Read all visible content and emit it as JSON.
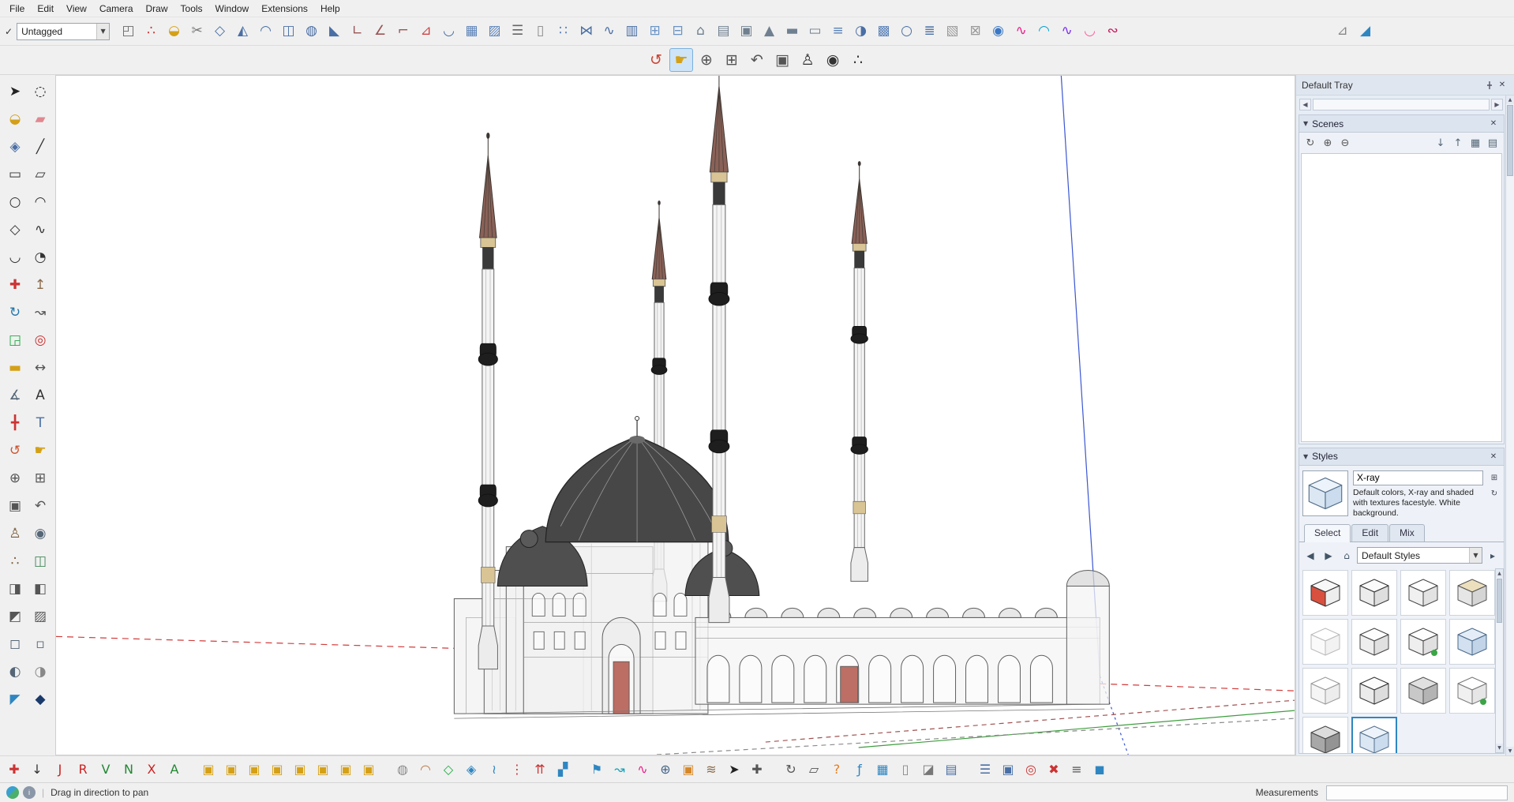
{
  "menu": {
    "items": [
      {
        "name": "menu-file",
        "label": "File"
      },
      {
        "name": "menu-edit",
        "label": "Edit"
      },
      {
        "name": "menu-view",
        "label": "View"
      },
      {
        "name": "menu-camera",
        "label": "Camera"
      },
      {
        "name": "menu-draw",
        "label": "Draw"
      },
      {
        "name": "menu-tools",
        "label": "Tools"
      },
      {
        "name": "menu-window",
        "label": "Window"
      },
      {
        "name": "menu-extensions",
        "label": "Extensions"
      },
      {
        "name": "menu-help",
        "label": "Help"
      }
    ]
  },
  "top_toolbar": {
    "tag_filter": {
      "value": "Untagged"
    },
    "icons": [
      {
        "name": "corner-tool-icon",
        "g": "◰",
        "c": "#6a6a6a"
      },
      {
        "name": "points-tool-icon",
        "g": "∴",
        "c": "#cc3333"
      },
      {
        "name": "drape-tool-icon",
        "g": "◒",
        "c": "#d4a017"
      },
      {
        "name": "cut-tool-icon",
        "g": "✂",
        "c": "#777777"
      },
      {
        "name": "polygon-tool-icon",
        "g": "◇",
        "c": "#4a6fa5"
      },
      {
        "name": "outline-tool-icon",
        "g": "◭",
        "c": "#4a6fa5"
      },
      {
        "name": "sweep-tool-icon",
        "g": "◠",
        "c": "#4a6fa5"
      },
      {
        "name": "extrude-tool-icon",
        "g": "◫",
        "c": "#4a6fa5"
      },
      {
        "name": "sphere-tool-icon",
        "g": "◍",
        "c": "#4a6fa5"
      },
      {
        "name": "taper-tool-icon",
        "g": "◣",
        "c": "#4a6fa5"
      },
      {
        "name": "angle-corner-tool-icon",
        "g": "∟",
        "c": "#995555"
      },
      {
        "name": "angle-tool-icon",
        "g": "∠",
        "c": "#995555"
      },
      {
        "name": "guide-tool-icon",
        "g": "⌐",
        "c": "#995555"
      },
      {
        "name": "slope-tool-icon",
        "g": "⊿",
        "c": "#cc4444"
      },
      {
        "name": "arc-tool-icon",
        "g": "◡",
        "c": "#4a6fa5"
      },
      {
        "name": "grid-tool-icon",
        "g": "▦",
        "c": "#5b82b8"
      },
      {
        "name": "hatch-tool-icon",
        "g": "▨",
        "c": "#5b82b8"
      },
      {
        "name": "stairs-tool-icon",
        "g": "☰",
        "c": "#666666"
      },
      {
        "name": "column-tool-icon",
        "g": "▯",
        "c": "#888888"
      },
      {
        "name": "array-tool-icon",
        "g": "∷",
        "c": "#5b82b8"
      },
      {
        "name": "mirror-tool-icon",
        "g": "⋈",
        "c": "#4a6fa5"
      },
      {
        "name": "path-array-tool-icon",
        "g": "∿",
        "c": "#4a6fa5"
      },
      {
        "name": "fence-tool-icon",
        "g": "▥",
        "c": "#4a6fa5"
      },
      {
        "name": "window-tool-icon",
        "g": "⊞",
        "c": "#6b93c4"
      },
      {
        "name": "door-tool-icon",
        "g": "⊟",
        "c": "#6b93c4"
      },
      {
        "name": "roof-tool-icon",
        "g": "⌂",
        "c": "#708090"
      },
      {
        "name": "wall-tool-icon",
        "g": "▤",
        "c": "#708090"
      },
      {
        "name": "frame-tool-icon",
        "g": "▣",
        "c": "#708090"
      },
      {
        "name": "truss-tool-icon",
        "g": "▲",
        "c": "#708090"
      },
      {
        "name": "beam-tool-icon",
        "g": "▬",
        "c": "#708090"
      },
      {
        "name": "panel-tool-icon",
        "g": "▭",
        "c": "#708090"
      },
      {
        "name": "louver-tool-icon",
        "g": "≡",
        "c": "#5b82b8"
      },
      {
        "name": "shell-tool-icon",
        "g": "◑",
        "c": "#4a6fa5"
      },
      {
        "name": "lattice-tool-icon",
        "g": "▩",
        "c": "#5b82b8"
      },
      {
        "name": "pipe-tool-icon",
        "g": "○",
        "c": "#4a6fa5"
      },
      {
        "name": "rail-tool-icon",
        "g": "≣",
        "c": "#4a6fa5"
      },
      {
        "name": "texture-tool-icon",
        "g": "▧",
        "c": "#999999"
      },
      {
        "name": "uv-map-tool-icon",
        "g": "⊠",
        "c": "#999999"
      },
      {
        "name": "instructor-icon",
        "g": "◉",
        "c": "#3b78c4"
      },
      {
        "name": "bezier-tool-icon",
        "g": "∿",
        "c": "#e91e8c"
      },
      {
        "name": "spline-tool-icon",
        "g": "◠",
        "c": "#00a0d0"
      },
      {
        "name": "curve-tool-icon",
        "g": "∿",
        "c": "#7b2ff2"
      },
      {
        "name": "freehand-curve-tool-icon",
        "g": "◡",
        "c": "#ff5aa0"
      },
      {
        "name": "curve-edit-tool-icon",
        "g": "∾",
        "c": "#c2185b"
      },
      {
        "name": "profile-builder-icon",
        "g": "⊿",
        "c": "#888888"
      },
      {
        "name": "slope-gradient-icon",
        "g": "◢",
        "c": "#2e86c1"
      }
    ]
  },
  "camera_toolbar": {
    "icons": [
      {
        "name": "orbit-tool-icon",
        "g": "↺",
        "c": "#cc4433"
      },
      {
        "name": "pan-tool-icon",
        "g": "☛",
        "c": "#d4a017",
        "active": true
      },
      {
        "name": "zoom-tool-icon",
        "g": "⊕",
        "c": "#555555"
      },
      {
        "name": "zoom-window-tool-icon",
        "g": "⊞",
        "c": "#555555"
      },
      {
        "name": "zoom-previous-tool-icon",
        "g": "↶",
        "c": "#555555"
      },
      {
        "name": "zoom-extents-tool-icon",
        "g": "▣",
        "c": "#555555"
      },
      {
        "name": "position-camera-tool-icon",
        "g": "♙",
        "c": "#333333"
      },
      {
        "name": "look-around-tool-icon",
        "g": "◉",
        "c": "#333333"
      },
      {
        "name": "walk-tool-icon",
        "g": "∴",
        "c": "#333333"
      }
    ]
  },
  "left_toolbar": {
    "icons": [
      {
        "name": "select-tool-icon",
        "g": "➤",
        "c": "#222222"
      },
      {
        "name": "lasso-select-tool-icon",
        "g": "◌",
        "c": "#222222"
      },
      {
        "name": "paint-bucket-tool-icon",
        "g": "◒",
        "c": "#d4a017"
      },
      {
        "name": "eraser-tool-icon",
        "g": "▰",
        "c": "#e08890"
      },
      {
        "name": "make-component-tool-icon",
        "g": "◈",
        "c": "#4a6fa5"
      },
      {
        "name": "line-tool-icon",
        "g": "╱",
        "c": "#333333"
      },
      {
        "name": "rectangle-tool-icon",
        "g": "▭",
        "c": "#333333"
      },
      {
        "name": "rotated-rectangle-tool-icon",
        "g": "▱",
        "c": "#333333"
      },
      {
        "name": "circle-tool-icon",
        "g": "○",
        "c": "#333333"
      },
      {
        "name": "arc-tool-icon",
        "g": "◠",
        "c": "#333333"
      },
      {
        "name": "polygon-tool-icon",
        "g": "◇",
        "c": "#333333"
      },
      {
        "name": "freehand-tool-icon",
        "g": "∿",
        "c": "#333333"
      },
      {
        "name": "two-point-arc-tool-icon",
        "g": "◡",
        "c": "#333333"
      },
      {
        "name": "pie-tool-icon",
        "g": "◔",
        "c": "#333333"
      },
      {
        "name": "move-tool-icon",
        "g": "✚",
        "c": "#cc3333"
      },
      {
        "name": "push-pull-tool-icon",
        "g": "↥",
        "c": "#8a6a4a"
      },
      {
        "name": "rotate-tool-icon",
        "g": "↻",
        "c": "#2277aa"
      },
      {
        "name": "follow-me-tool-icon",
        "g": "↝",
        "c": "#555555"
      },
      {
        "name": "scale-tool-icon",
        "g": "◲",
        "c": "#22aa44"
      },
      {
        "name": "offset-tool-icon",
        "g": "◎",
        "c": "#cc3333"
      },
      {
        "name": "tape-measure-tool-icon",
        "g": "▬",
        "c": "#d4a017"
      },
      {
        "name": "dimension-tool-icon",
        "g": "↔",
        "c": "#555555"
      },
      {
        "name": "protractor-tool-icon",
        "g": "∡",
        "c": "#556677"
      },
      {
        "name": "text-tool-icon",
        "g": "A",
        "c": "#333333"
      },
      {
        "name": "axes-tool-icon",
        "g": "╋",
        "c": "#cc3333"
      },
      {
        "name": "3d-text-tool-icon",
        "g": "T",
        "c": "#4a6fa5"
      },
      {
        "name": "orbit-tool-icon",
        "g": "↺",
        "c": "#cc5533"
      },
      {
        "name": "pan-tool-icon",
        "g": "☛",
        "c": "#d4a017"
      },
      {
        "name": "zoom-tool-icon",
        "g": "⊕",
        "c": "#555555"
      },
      {
        "name": "zoom-window-tool-icon",
        "g": "⊞",
        "c": "#555555"
      },
      {
        "name": "zoom-extents-tool-icon",
        "g": "▣",
        "c": "#555555"
      },
      {
        "name": "zoom-previous-tool-icon",
        "g": "↶",
        "c": "#555555"
      },
      {
        "name": "position-camera-tool-icon",
        "g": "♙",
        "c": "#7a5a3a"
      },
      {
        "name": "look-around-tool-icon",
        "g": "◉",
        "c": "#556677"
      },
      {
        "name": "walk-tool-icon",
        "g": "∴",
        "c": "#7a5a3a"
      },
      {
        "name": "section-plane-tool-icon",
        "g": "◫",
        "c": "#44885a"
      },
      {
        "name": "section-display-toggle-icon",
        "g": "◨",
        "c": "#555555"
      },
      {
        "name": "section-cut-toggle-icon",
        "g": "◧",
        "c": "#555555"
      },
      {
        "name": "section-fill-toggle-icon",
        "g": "◩",
        "c": "#555555"
      },
      {
        "name": "back-edges-toggle-icon",
        "g": "▨",
        "c": "#555555"
      },
      {
        "name": "xray-mode-toggle-icon",
        "g": "◻",
        "c": "#556677"
      },
      {
        "name": "wireframe-toggle-icon",
        "g": "▫",
        "c": "#556677"
      },
      {
        "name": "shaded-toggle-icon",
        "g": "◐",
        "c": "#556677"
      },
      {
        "name": "monochrome-toggle-icon",
        "g": "◑",
        "c": "#888888"
      },
      {
        "name": "extension-toggle-icon",
        "g": "◤",
        "c": "#2e86c1"
      },
      {
        "name": "extension-cube-icon",
        "g": "◆",
        "c": "#1a3a6b"
      }
    ]
  },
  "bottom_toolbar": {
    "icons": [
      {
        "name": "north-arrow-icon",
        "g": "✚",
        "c": "#cc3333"
      },
      {
        "name": "drop-vertical-icon",
        "g": "↓",
        "c": "#333333"
      },
      {
        "name": "jhs-j-icon",
        "g": "J",
        "c": "#cc2222"
      },
      {
        "name": "jhs-r-icon",
        "g": "R",
        "c": "#cc2222"
      },
      {
        "name": "jhs-v-icon",
        "g": "V",
        "c": "#228833"
      },
      {
        "name": "jhs-n-icon",
        "g": "N",
        "c": "#228833"
      },
      {
        "name": "jhs-x-icon",
        "g": "X",
        "c": "#cc2222"
      },
      {
        "name": "jhs-a-icon",
        "g": "A",
        "c": "#228833"
      },
      {
        "name": "fredoscale-box-icon",
        "g": "▣",
        "c": "#d4a017"
      },
      {
        "name": "fredoscale-taper-icon",
        "g": "▣",
        "c": "#d4a017"
      },
      {
        "name": "fredoscale-twist-icon",
        "g": "▣",
        "c": "#d4a017"
      },
      {
        "name": "fredoscale-bend-icon",
        "g": "▣",
        "c": "#d4a017"
      },
      {
        "name": "fredoscale-shear-icon",
        "g": "▣",
        "c": "#d4a017"
      },
      {
        "name": "fredoscale-stretch-icon",
        "g": "▣",
        "c": "#d4a017"
      },
      {
        "name": "fredoscale-rotate-icon",
        "g": "▣",
        "c": "#d4a017"
      },
      {
        "name": "fredoscale-radial-icon",
        "g": "▣",
        "c": "#d4a017"
      },
      {
        "name": "soap-bubble-icon",
        "g": "◍",
        "c": "#8a8a8a"
      },
      {
        "name": "dome-icon",
        "g": "◠",
        "c": "#c07a4a"
      },
      {
        "name": "vertex-tools-icon",
        "g": "◇",
        "c": "#22aa44"
      },
      {
        "name": "cleanup-icon",
        "g": "◈",
        "c": "#2e86c1"
      },
      {
        "name": "edge-tools-icon",
        "g": "≀",
        "c": "#2e86c1"
      },
      {
        "name": "stray-lines-icon",
        "g": "⋮",
        "c": "#cc3333"
      },
      {
        "name": "arrows-up-icon",
        "g": "⇈",
        "c": "#cc3333"
      },
      {
        "name": "merge-faces-icon",
        "g": "▞",
        "c": "#2e86c1"
      },
      {
        "name": "flag-icon",
        "g": "⚑",
        "c": "#2e86c1"
      },
      {
        "name": "curvizard-icon",
        "g": "↝",
        "c": "#17a2b8"
      },
      {
        "name": "pink-curve-icon",
        "g": "∿",
        "c": "#e91e8c"
      },
      {
        "name": "geo-location-icon",
        "g": "⊕",
        "c": "#446688"
      },
      {
        "name": "photo-texture-icon",
        "g": "▣",
        "c": "#d4882a"
      },
      {
        "name": "sandbox-icon",
        "g": "≋",
        "c": "#8a6a4a"
      },
      {
        "name": "select-arrow-icon",
        "g": "➤",
        "c": "#222222"
      },
      {
        "name": "move-icon",
        "g": "✚",
        "c": "#555555"
      },
      {
        "name": "rotate-icon",
        "g": "↻",
        "c": "#555555"
      },
      {
        "name": "scale-icon",
        "g": "▱",
        "c": "#555555"
      },
      {
        "name": "help-icon",
        "g": "?",
        "c": "#e67e22"
      },
      {
        "name": "jhs-powerbar-icon",
        "g": "ƒ",
        "c": "#2e86c1"
      },
      {
        "name": "grid-display-icon",
        "g": "▦",
        "c": "#2e86c1"
      },
      {
        "name": "column-white-icon",
        "g": "▯",
        "c": "#888888"
      },
      {
        "name": "shadow-box-icon",
        "g": "◪",
        "c": "#777777"
      },
      {
        "name": "layers-panel-icon",
        "g": "▤",
        "c": "#4a6fa5"
      },
      {
        "name": "outliner-panel-icon",
        "g": "☰",
        "c": "#4a6fa5"
      },
      {
        "name": "components-panel-icon",
        "g": "▣",
        "c": "#4a6fa5"
      },
      {
        "name": "red-snap-icon",
        "g": "◎",
        "c": "#cc3333"
      },
      {
        "name": "axes-reset-icon",
        "g": "✖",
        "c": "#cc3333"
      },
      {
        "name": "stack-icon",
        "g": "≡",
        "c": "#555555"
      },
      {
        "name": "blue-cube-icon",
        "g": "◼",
        "c": "#2e86c1"
      }
    ]
  },
  "viewport": {
    "axis_colors": {
      "red": "#d23b3b",
      "green": "#3f9d3f",
      "blue": "#3b56d2"
    }
  },
  "tray": {
    "title": "Default Tray",
    "scenes": {
      "title": "Scenes",
      "toolbar_left": [
        {
          "name": "update-scene-button",
          "g": "↻",
          "c": "#555555"
        },
        {
          "name": "add-scene-button",
          "g": "⊕",
          "c": "#555555"
        },
        {
          "name": "remove-scene-button",
          "g": "⊖",
          "c": "#555555"
        }
      ],
      "toolbar_right": [
        {
          "name": "move-scene-down-button",
          "g": "↓",
          "c": "#556677"
        },
        {
          "name": "move-scene-up-button",
          "g": "↑",
          "c": "#556677"
        },
        {
          "name": "view-options-button",
          "g": "▦",
          "c": "#556677"
        },
        {
          "name": "scene-details-button",
          "g": "▤",
          "c": "#556677"
        }
      ]
    },
    "styles": {
      "title": "Styles",
      "style_name": "X-ray",
      "description": "Default colors, X-ray and shaded with textures facestyle. White background.",
      "tabs": [
        {
          "name": "tab-select",
          "label": "Select",
          "active": true
        },
        {
          "name": "tab-edit",
          "label": "Edit"
        },
        {
          "name": "tab-mix",
          "label": "Mix"
        }
      ],
      "collection": "Default Styles",
      "thumbnails": [
        {
          "name": "style-thumbnail-1",
          "top": "#f8f8f8",
          "left": "#d9503f",
          "right": "#eeeeee",
          "stroke": "#333333"
        },
        {
          "name": "style-thumbnail-2",
          "top": "#fbfbfb",
          "left": "#ececec",
          "right": "#dedede",
          "stroke": "#333333"
        },
        {
          "name": "style-thumbnail-3",
          "top": "#ffffff",
          "left": "#f0f0f0",
          "right": "#e2e2e2",
          "stroke": "#444444"
        },
        {
          "name": "style-thumbnail-4",
          "top": "#ecdfbd",
          "left": "#e6e6e6",
          "right": "#d5d5d5",
          "stroke": "#555555"
        },
        {
          "name": "style-thumbnail-5",
          "top": "#ffffff",
          "left": "#fafafa",
          "right": "#f2f2f2",
          "stroke": "#bbbbbb"
        },
        {
          "name": "style-thumbnail-6",
          "top": "#fdfdfd",
          "left": "#eeeeee",
          "right": "#e0e0e0",
          "stroke": "#444444"
        },
        {
          "name": "style-thumbnail-7",
          "top": "#fdfdfd",
          "left": "#eeeeee",
          "right": "#e0e0e0",
          "stroke": "#444444",
          "badge": true
        },
        {
          "name": "style-thumbnail-8",
          "top": "#e4edf7",
          "left": "#d2e0ef",
          "right": "#c2d4e8",
          "stroke": "#4a6a8a"
        },
        {
          "name": "style-thumbnail-9",
          "top": "#ffffff",
          "left": "#f5f5f5",
          "right": "#ededed",
          "stroke": "#999999"
        },
        {
          "name": "style-thumbnail-10",
          "top": "#fcfcfc",
          "left": "#ebebeb",
          "right": "#dddddd",
          "stroke": "#333333"
        },
        {
          "name": "style-thumbnail-11",
          "top": "#e0e0e0",
          "left": "#c8c8c8",
          "right": "#b4b4b4",
          "stroke": "#555555"
        },
        {
          "name": "style-thumbnail-12",
          "top": "#ffffff",
          "left": "#f0f0f0",
          "right": "#e6e6e6",
          "stroke": "#777777",
          "badge": true
        },
        {
          "name": "style-thumbnail-13",
          "top": "#dcdcdc",
          "left": "#a8a8a8",
          "right": "#949494",
          "stroke": "#444444"
        },
        {
          "name": "style-thumbnail-14",
          "top": "#edf3fa",
          "left": "#dbe7f3",
          "right": "#cadcee",
          "stroke": "#55708c",
          "sel": true
        }
      ]
    }
  },
  "status_bar": {
    "hint": "Drag in direction to pan",
    "measurements_label": "Measurements",
    "measurements_value": ""
  }
}
